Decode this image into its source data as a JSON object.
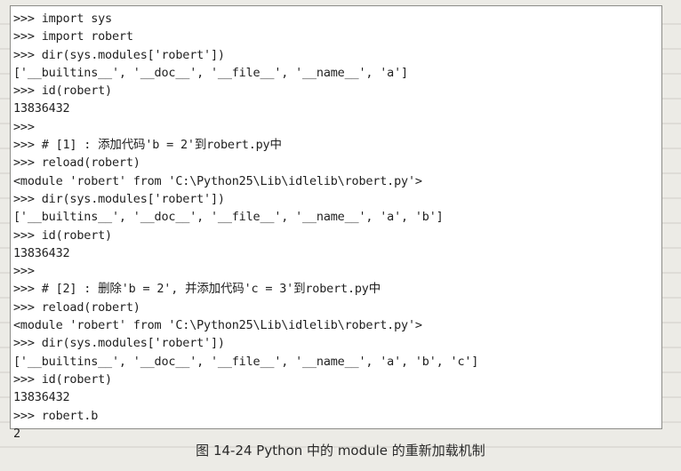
{
  "code_lines": [
    ">>> import sys",
    ">>> import robert",
    ">>> dir(sys.modules['robert'])",
    "['__builtins__', '__doc__', '__file__', '__name__', 'a']",
    ">>> id(robert)",
    "13836432",
    ">>>",
    ">>> # [1] : 添加代码'b = 2'到robert.py中",
    ">>> reload(robert)",
    "<module 'robert' from 'C:\\Python25\\Lib\\idlelib\\robert.py'>",
    ">>> dir(sys.modules['robert'])",
    "['__builtins__', '__doc__', '__file__', '__name__', 'a', 'b']",
    ">>> id(robert)",
    "13836432",
    ">>>",
    ">>> # [2] : 删除'b = 2', 并添加代码'c = 3'到robert.py中",
    ">>> reload(robert)",
    "<module 'robert' from 'C:\\Python25\\Lib\\idlelib\\robert.py'>",
    ">>> dir(sys.modules['robert'])",
    "['__builtins__', '__doc__', '__file__', '__name__', 'a', 'b', 'c']",
    ">>> id(robert)",
    "13836432",
    ">>> robert.b",
    "2"
  ],
  "caption": "图 14-24  Python 中的 module 的重新加载机制"
}
